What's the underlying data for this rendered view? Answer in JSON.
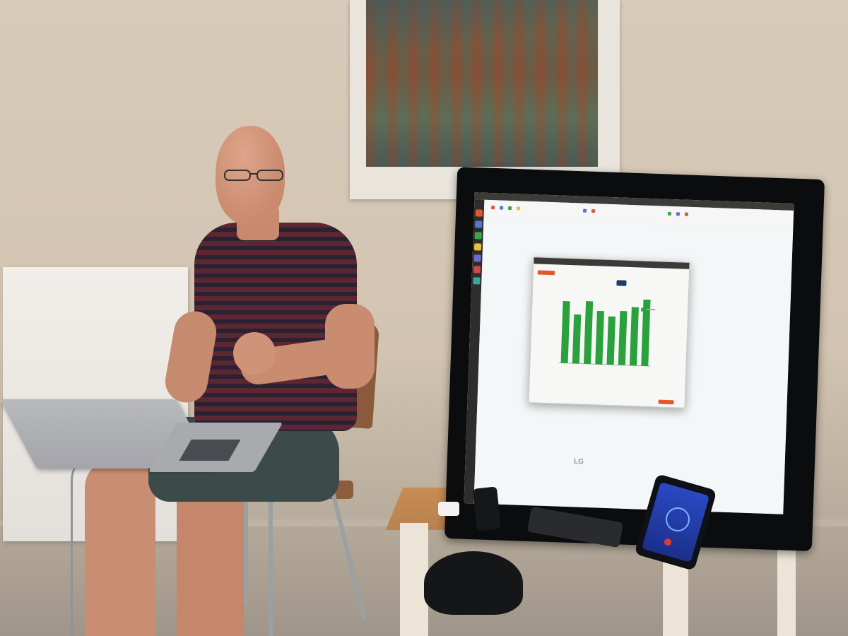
{
  "scene": {
    "description_free": true
  },
  "tv": {
    "brand": "LG"
  },
  "screen_chart": {
    "chart_data": {
      "type": "bar",
      "categories": [
        "",
        "",
        "",
        "",
        "",
        "",
        "",
        ""
      ],
      "values": [
        86,
        68,
        87,
        74,
        67,
        75,
        81,
        92
      ],
      "ylim": [
        0,
        100
      ],
      "bar_color": "#2aa13d"
    }
  },
  "colors": {
    "bar_green": "#2aa13d",
    "accent_orange": "#e2572d",
    "phone_blue": "#2a49c2"
  }
}
